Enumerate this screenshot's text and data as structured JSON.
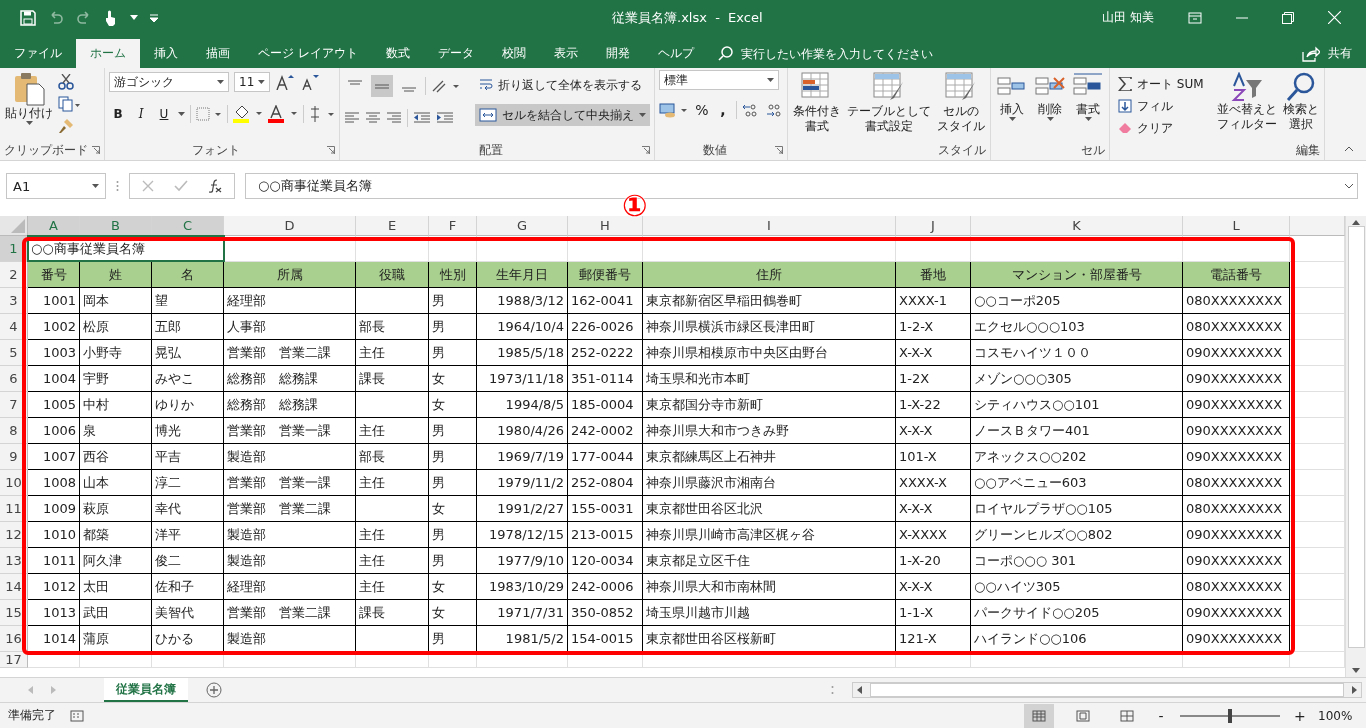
{
  "title_bar": {
    "title": "従業員名簿.xlsx  -  Excel",
    "user": "山田 知美"
  },
  "menu_tabs": [
    {
      "label": "ファイル",
      "selected": false
    },
    {
      "label": "ホーム",
      "selected": true
    },
    {
      "label": "挿入",
      "selected": false
    },
    {
      "label": "描画",
      "selected": false
    },
    {
      "label": "ページ レイアウト",
      "selected": false
    },
    {
      "label": "数式",
      "selected": false
    },
    {
      "label": "データ",
      "selected": false
    },
    {
      "label": "校閲",
      "selected": false
    },
    {
      "label": "表示",
      "selected": false
    },
    {
      "label": "開発",
      "selected": false
    },
    {
      "label": "ヘルプ",
      "selected": false
    }
  ],
  "tell_me": {
    "placeholder": "実行したい作業を入力してください"
  },
  "share": "共有",
  "ribbon": {
    "clipboard": {
      "label": "クリップボード",
      "paste": "貼り付け"
    },
    "font": {
      "label": "フォント",
      "font_name": "游ゴシック",
      "font_size": "11",
      "bold": "B",
      "italic": "I",
      "underline": "U"
    },
    "alignment": {
      "label": "配置",
      "vertical": [
        {
          "selected": false
        },
        {
          "selected": true
        },
        {
          "selected": false
        }
      ],
      "wrap": "折り返して全体を表示する",
      "merge": {
        "label": "セルを結合して中央揃え",
        "selected": true
      }
    },
    "number": {
      "label": "数値",
      "format": "標準",
      "percent": "%",
      "comma": ","
    },
    "styles": {
      "label": "スタイル",
      "buttons": [
        [
          "条件付き",
          "書式"
        ],
        [
          "テーブルとして",
          "書式設定"
        ],
        [
          "セルの",
          "スタイル"
        ]
      ]
    },
    "cells": {
      "label": "セル",
      "buttons": [
        "挿入",
        "削除",
        "書式"
      ]
    },
    "editing": {
      "label": "編集",
      "autosum": "オート SUM",
      "fill": "フィル",
      "clear": "クリア",
      "sort": [
        "並べ替えと",
        "フィルター"
      ],
      "find": [
        "検索と",
        "選択"
      ]
    }
  },
  "name_box": "A1",
  "formula": "○○商事従業員名簿",
  "annotation_marker": "①",
  "sheet": {
    "columns": [
      {
        "label": "A",
        "selected": true
      },
      {
        "label": "B",
        "selected": true
      },
      {
        "label": "C",
        "selected": true
      },
      {
        "label": "D",
        "selected": false
      },
      {
        "label": "E",
        "selected": false
      },
      {
        "label": "F",
        "selected": false
      },
      {
        "label": "G",
        "selected": false
      },
      {
        "label": "H",
        "selected": false
      },
      {
        "label": "I",
        "selected": false
      },
      {
        "label": "J",
        "selected": false
      },
      {
        "label": "K",
        "selected": false
      },
      {
        "label": "L",
        "selected": false
      }
    ],
    "title_row": {
      "row": "1",
      "text": "○○商事従業員名簿",
      "selected": true
    },
    "header_row": {
      "row": "2",
      "labels": [
        "番号",
        "姓",
        "名",
        "所属",
        "役職",
        "性別",
        "生年月日",
        "郵便番号",
        "住所",
        "番地",
        "マンション・部屋番号",
        "電話番号"
      ]
    },
    "rows": [
      {
        "row": "3",
        "no": "1001",
        "last": "岡本",
        "first": "望",
        "dept": "経理部",
        "gender": "男",
        "birth": "1988/3/12",
        "zip": "162-0041",
        "address": "東京都新宿区早稲田鶴巻町",
        "lot": "XXXX-1",
        "building": "○○コーポ205",
        "phone": "080XXXXXXXX"
      },
      {
        "row": "4",
        "no": "1002",
        "last": "松原",
        "first": "五郎",
        "dept": "人事部",
        "role": "部長",
        "gender": "男",
        "birth": "1964/10/4",
        "zip": "226-0026",
        "address": "神奈川県横浜市緑区長津田町",
        "lot": "1-2-X",
        "building": "エクセル○○○103",
        "phone": "080XXXXXXXX"
      },
      {
        "row": "5",
        "no": "1003",
        "last": "小野寺",
        "first": "晃弘",
        "dept": "営業部　営業二課",
        "role": "主任",
        "gender": "男",
        "birth": "1985/5/18",
        "zip": "252-0222",
        "address": "神奈川県相模原市中央区由野台",
        "lot": "X-X-X",
        "building": "コスモハイツ１００",
        "phone": "090XXXXXXXX"
      },
      {
        "row": "6",
        "no": "1004",
        "last": "宇野",
        "first": "みやこ",
        "dept": "総務部　総務課",
        "role": "課長",
        "gender": "女",
        "birth": "1973/11/18",
        "zip": "351-0114",
        "address": "埼玉県和光市本町",
        "lot": "1-2X",
        "building": "メゾン○○○305",
        "phone": "090XXXXXXXX"
      },
      {
        "row": "7",
        "no": "1005",
        "last": "中村",
        "first": "ゆりか",
        "dept": "総務部　総務課",
        "gender": "女",
        "birth": "1994/8/5",
        "zip": "185-0004",
        "address": "東京都国分寺市新町",
        "lot": "1-X-22",
        "building": "シティハウス○○101",
        "phone": "090XXXXXXXX"
      },
      {
        "row": "8",
        "no": "1006",
        "last": "泉",
        "first": "博光",
        "dept": "営業部　営業一課",
        "role": "主任",
        "gender": "男",
        "birth": "1980/4/26",
        "zip": "242-0002",
        "address": "神奈川県大和市つきみ野",
        "lot": "X-X-X",
        "building": "ノースＢタワー401",
        "phone": "090XXXXXXXX"
      },
      {
        "row": "9",
        "no": "1007",
        "last": "西谷",
        "first": "平吉",
        "dept": "製造部",
        "role": "部長",
        "gender": "男",
        "birth": "1969/7/19",
        "zip": "177-0044",
        "address": "東京都練馬区上石神井",
        "lot": "101-X",
        "building": "アネックス○○202",
        "phone": "090XXXXXXXX"
      },
      {
        "row": "10",
        "no": "1008",
        "last": "山本",
        "first": "淳二",
        "dept": "営業部　営業一課",
        "role": "主任",
        "gender": "男",
        "birth": "1979/11/2",
        "zip": "252-0804",
        "address": "神奈川県藤沢市湘南台",
        "lot": "XXXX-X",
        "building": "○○アベニュー603",
        "phone": "080XXXXXXXX"
      },
      {
        "row": "11",
        "no": "1009",
        "last": "萩原",
        "first": "幸代",
        "dept": "営業部　営業二課",
        "gender": "女",
        "birth": "1991/2/27",
        "zip": "155-0031",
        "address": "東京都世田谷区北沢",
        "lot": "X-X-X",
        "building": "ロイヤルプラザ○○105",
        "phone": "080XXXXXXXX"
      },
      {
        "row": "12",
        "no": "1010",
        "last": "都築",
        "first": "洋平",
        "dept": "製造部",
        "role": "主任",
        "gender": "男",
        "birth": "1978/12/15",
        "zip": "213-0015",
        "address": "神奈川県川崎市高津区梶ヶ谷",
        "lot": "X-XXXX",
        "building": "グリーンヒルズ○○802",
        "phone": "090XXXXXXXX"
      },
      {
        "row": "13",
        "no": "1011",
        "last": "阿久津",
        "first": "俊二",
        "dept": "製造部",
        "role": "主任",
        "gender": "男",
        "birth": "1977/9/10",
        "zip": "120-0034",
        "address": "東京都足立区千住",
        "lot": "1-X-20",
        "building": "コーポ○○○ 301",
        "phone": "090XXXXXXXX"
      },
      {
        "row": "14",
        "no": "1012",
        "last": "太田",
        "first": "佐和子",
        "dept": "経理部",
        "role": "主任",
        "gender": "女",
        "birth": "1983/10/29",
        "zip": "242-0006",
        "address": "神奈川県大和市南林間",
        "lot": "X-X-X",
        "building": "○○ハイツ305",
        "phone": "080XXXXXXXX"
      },
      {
        "row": "15",
        "no": "1013",
        "last": "武田",
        "first": "美智代",
        "dept": "営業部　営業二課",
        "role": "課長",
        "gender": "女",
        "birth": "1971/7/31",
        "zip": "350-0852",
        "address": "埼玉県川越市川越",
        "lot": "1-1-X",
        "building": "パークサイド○○205",
        "phone": "090XXXXXXXX"
      },
      {
        "row": "16",
        "no": "1014",
        "last": "蒲原",
        "first": "ひかる",
        "dept": "製造部",
        "gender": "男",
        "birth": "1981/5/2",
        "zip": "154-0015",
        "address": "東京都世田谷区桜新町",
        "lot": "121-X",
        "building": "ハイランド○○106",
        "phone": "090XXXXXXXX"
      }
    ],
    "empty_rows": [
      "17"
    ]
  },
  "sheet_tabs": [
    {
      "label": "従業員名簿",
      "selected": true
    }
  ],
  "status": "準備完了",
  "views": [
    {
      "selected": true
    },
    {
      "selected": false
    },
    {
      "selected": false
    }
  ],
  "zoom": {
    "minus": "-",
    "plus": "+",
    "level": 0.5,
    "reading": "100%"
  }
}
